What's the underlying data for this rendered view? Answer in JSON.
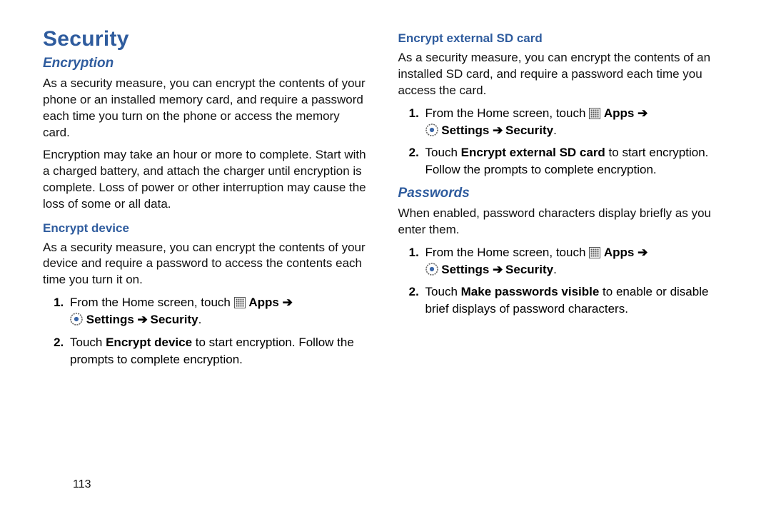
{
  "page_number": "113",
  "arrow": "➔",
  "h1": "Security",
  "h2_encryption": "Encryption",
  "p_enc_intro": "As a security measure, you can encrypt the contents of your phone or an installed memory card, and require a password each time you turn on the phone or access the memory card.",
  "p_enc_warn": "Encryption may take an hour or more to complete. Start with a charged battery, and attach the charger until encryption is complete. Loss of power or other interruption may cause the loss of some or all data.",
  "h3_enc_device": "Encrypt device",
  "p_enc_device": "As a security measure, you can encrypt the contents of your device and require a password to access the contents each time you turn it on.",
  "step_from_home_a": "From the Home screen, touch ",
  "step_apps": "Apps",
  "step_settings": "Settings",
  "step_security": "Security",
  "step_enc_device_touch_a": "Touch ",
  "step_enc_device_bold": "Encrypt device",
  "step_enc_device_touch_b": " to start encryption. Follow the prompts to complete encryption.",
  "h3_enc_sd": "Encrypt external SD card",
  "p_enc_sd": "As a security measure, you can encrypt the contents of an installed SD card, and require a password each time you access the card.",
  "step_enc_sd_touch_a": "Touch ",
  "step_enc_sd_bold": "Encrypt external SD card",
  "step_enc_sd_touch_b": " to start encryption. Follow the prompts to complete encryption.",
  "h2_passwords": "Passwords",
  "p_passwords": "When enabled, password characters display briefly as you enter them.",
  "step_pw_touch_a": "Touch ",
  "step_pw_bold": "Make passwords visible",
  "step_pw_touch_b": " to enable or disable brief displays of password characters."
}
